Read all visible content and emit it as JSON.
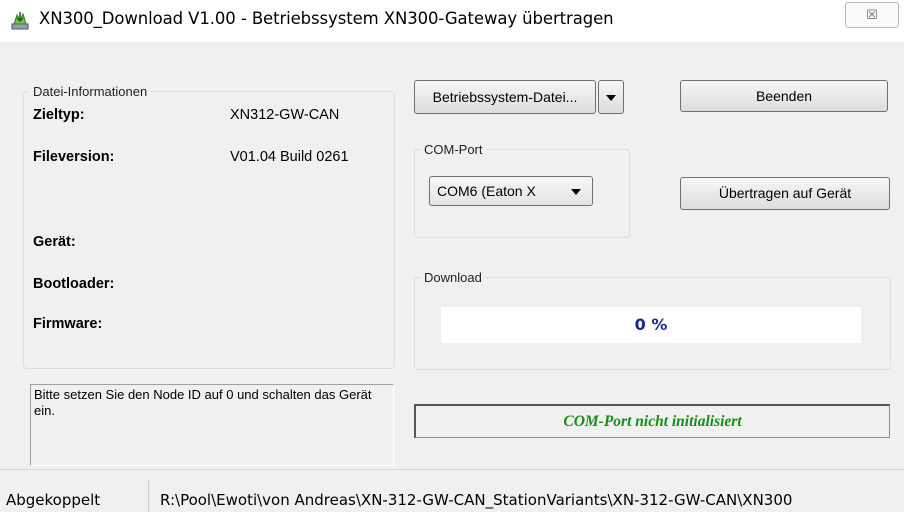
{
  "window": {
    "title": "XN300_Download V1.00 - Betriebssystem XN300-Gateway übertragen",
    "close_symbol": "☒"
  },
  "file_info": {
    "legend": "Datei-Informationen",
    "rows": [
      {
        "label": "Zieltyp:",
        "value": "XN312-GW-CAN"
      },
      {
        "label": "Fileversion:",
        "value": "V01.04 Build 0261"
      },
      {
        "label": "Gerät:",
        "value": ""
      },
      {
        "label": "Bootloader:",
        "value": ""
      },
      {
        "label": "Firmware:",
        "value": ""
      }
    ]
  },
  "buttons": {
    "os_file": "Betriebssystem-Datei...",
    "exit": "Beenden",
    "transfer": "Übertragen auf Gerät"
  },
  "com_port": {
    "legend": "COM-Port",
    "selected": "COM6 (Eaton X"
  },
  "download": {
    "legend": "Download",
    "progress_value": 0,
    "progress_text": "0 %"
  },
  "message": "Bitte setzen Sie den Node ID auf 0 und schalten das Gerät ein.",
  "status_message": "COM-Port nicht initialisiert",
  "statusbar": {
    "state": "Abgekoppelt",
    "path": "R:\\Pool\\Ewoti\\von Andreas\\XN-312-GW-CAN_StationVariants\\XN-312-GW-CAN\\XN300"
  },
  "colors": {
    "progress_text": "#1a2a8a",
    "status_message": "#1a8a1a"
  }
}
